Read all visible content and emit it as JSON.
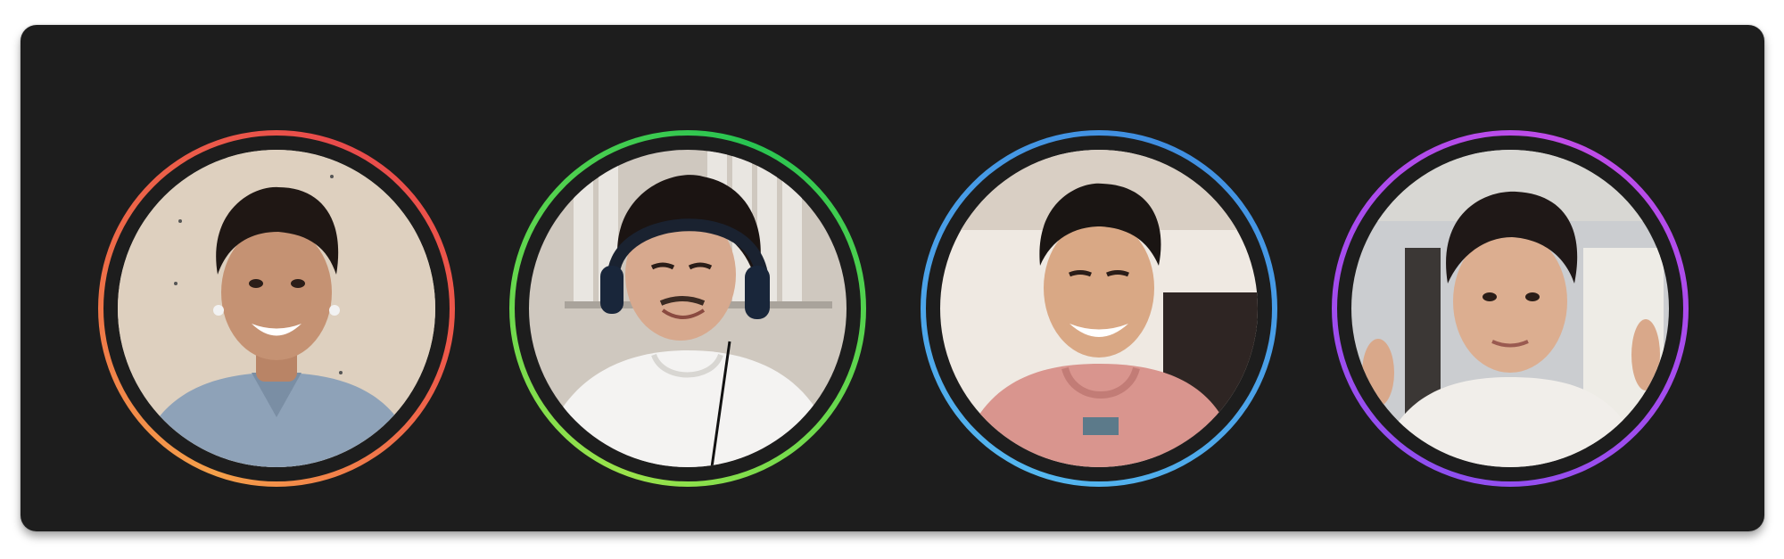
{
  "participants": [
    {
      "ring_colors": [
        "#f5a04a",
        "#e94b4b"
      ],
      "icon": "participant-video-feed"
    },
    {
      "ring_colors": [
        "#9be34b",
        "#28c451"
      ],
      "icon": "participant-video-feed"
    },
    {
      "ring_colors": [
        "#55b8f0",
        "#3f8de0"
      ],
      "icon": "participant-video-feed"
    },
    {
      "ring_colors": [
        "#8e4ff0",
        "#c04ce8"
      ],
      "icon": "participant-video-feed"
    }
  ]
}
